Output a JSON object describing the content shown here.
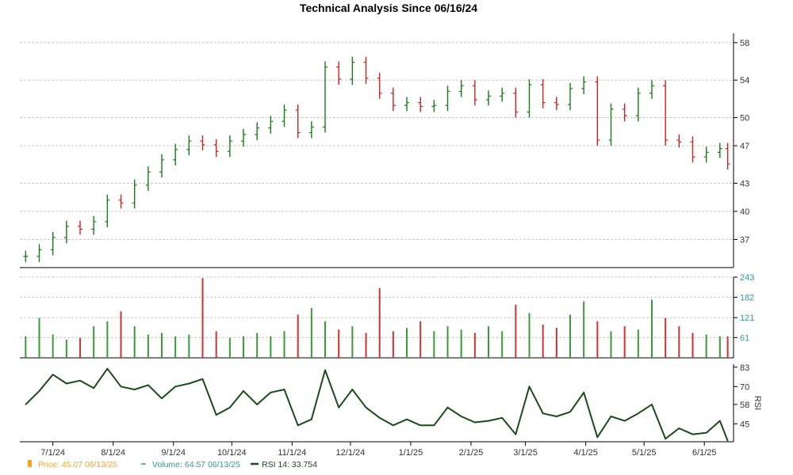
{
  "chart_data": {
    "type": "line",
    "title": "Technical Analysis Since 06/16/24",
    "x_ticks": [
      "7/1/24",
      "8/1/24",
      "9/1/24",
      "10/1/24",
      "11/1/24",
      "12/1/24",
      "1/1/25",
      "2/1/25",
      "3/1/25",
      "4/1/25",
      "5/1/25",
      "6/1/25"
    ],
    "price_panel": {
      "y_ticks": [
        37,
        40,
        43,
        47,
        50,
        54,
        58
      ],
      "ylim": [
        34,
        59
      ],
      "grid": true,
      "series": [
        {
          "name": "Price",
          "last_value": "45.07",
          "last_date": "06/13/25",
          "color_up": "#1a7a1a",
          "color_down": "#cc2222",
          "points": [
            [
              "2024-06-17",
              35.2
            ],
            [
              "2024-06-24",
              35.9
            ],
            [
              "2024-07-01",
              37.2
            ],
            [
              "2024-07-08",
              38.4
            ],
            [
              "2024-07-15",
              38.1
            ],
            [
              "2024-07-22",
              38.9
            ],
            [
              "2024-07-29",
              41.2
            ],
            [
              "2024-08-05",
              40.9
            ],
            [
              "2024-08-12",
              42.8
            ],
            [
              "2024-08-19",
              44.2
            ],
            [
              "2024-08-26",
              45.5
            ],
            [
              "2024-09-02",
              46.6
            ],
            [
              "2024-09-09",
              47.5
            ],
            [
              "2024-09-16",
              47.1
            ],
            [
              "2024-09-23",
              46.4
            ],
            [
              "2024-09-30",
              47.5
            ],
            [
              "2024-10-07",
              48.2
            ],
            [
              "2024-10-14",
              48.9
            ],
            [
              "2024-10-21",
              49.6
            ],
            [
              "2024-10-28",
              50.8
            ],
            [
              "2024-11-04",
              48.4
            ],
            [
              "2024-11-11",
              49.0
            ],
            [
              "2024-11-18",
              55.4
            ],
            [
              "2024-11-25",
              54.1
            ],
            [
              "2024-12-02",
              55.9
            ],
            [
              "2024-12-09",
              54.2
            ],
            [
              "2024-12-16",
              52.6
            ],
            [
              "2024-12-23",
              51.3
            ],
            [
              "2024-12-30",
              51.6
            ],
            [
              "2025-01-06",
              51.2
            ],
            [
              "2025-01-13",
              51.3
            ],
            [
              "2025-01-20",
              52.8
            ],
            [
              "2025-01-27",
              53.4
            ],
            [
              "2025-02-03",
              51.9
            ],
            [
              "2025-02-10",
              52.3
            ],
            [
              "2025-02-17",
              52.6
            ],
            [
              "2025-02-24",
              50.6
            ],
            [
              "2025-03-03",
              53.5
            ],
            [
              "2025-03-10",
              51.6
            ],
            [
              "2025-03-17",
              51.4
            ],
            [
              "2025-03-24",
              53.1
            ],
            [
              "2025-03-31",
              53.8
            ],
            [
              "2025-04-07",
              47.6
            ],
            [
              "2025-04-14",
              50.9
            ],
            [
              "2025-04-21",
              50.2
            ],
            [
              "2025-04-28",
              52.6
            ],
            [
              "2025-05-05",
              53.4
            ],
            [
              "2025-05-12",
              47.6
            ],
            [
              "2025-05-19",
              47.4
            ],
            [
              "2025-05-26",
              45.8
            ],
            [
              "2025-06-02",
              46.3
            ],
            [
              "2025-06-09",
              46.7
            ],
            [
              "2025-06-13",
              45.07
            ]
          ]
        }
      ]
    },
    "volume_panel": {
      "y_ticks": [
        61,
        121,
        182,
        243
      ],
      "ylim": [
        0,
        243
      ],
      "series": [
        {
          "name": "Volume",
          "last_value": "64.57",
          "last_date": "06/13/25",
          "color": "#339999",
          "points": [
            [
              "2024-06-17",
              65
            ],
            [
              "2024-06-24",
              120
            ],
            [
              "2024-07-01",
              70
            ],
            [
              "2024-07-08",
              55
            ],
            [
              "2024-07-15",
              60
            ],
            [
              "2024-07-22",
              95
            ],
            [
              "2024-07-29",
              110
            ],
            [
              "2024-08-05",
              140
            ],
            [
              "2024-08-12",
              95
            ],
            [
              "2024-08-19",
              70
            ],
            [
              "2024-08-26",
              75
            ],
            [
              "2024-09-02",
              65
            ],
            [
              "2024-09-09",
              70
            ],
            [
              "2024-09-16",
              240
            ],
            [
              "2024-09-23",
              80
            ],
            [
              "2024-09-30",
              60
            ],
            [
              "2024-10-07",
              65
            ],
            [
              "2024-10-14",
              75
            ],
            [
              "2024-10-21",
              65
            ],
            [
              "2024-10-28",
              80
            ],
            [
              "2024-11-04",
              130
            ],
            [
              "2024-11-11",
              150
            ],
            [
              "2024-11-18",
              110
            ],
            [
              "2024-11-25",
              85
            ],
            [
              "2024-12-02",
              95
            ],
            [
              "2024-12-09",
              75
            ],
            [
              "2024-12-16",
              210
            ],
            [
              "2024-12-23",
              80
            ],
            [
              "2024-12-30",
              90
            ],
            [
              "2025-01-06",
              110
            ],
            [
              "2025-01-13",
              80
            ],
            [
              "2025-01-20",
              95
            ],
            [
              "2025-01-27",
              85
            ],
            [
              "2025-02-03",
              75
            ],
            [
              "2025-02-10",
              95
            ],
            [
              "2025-02-17",
              80
            ],
            [
              "2025-02-24",
              160
            ],
            [
              "2025-03-03",
              135
            ],
            [
              "2025-03-10",
              100
            ],
            [
              "2025-03-17",
              90
            ],
            [
              "2025-03-24",
              130
            ],
            [
              "2025-03-31",
              170
            ],
            [
              "2025-04-07",
              110
            ],
            [
              "2025-04-14",
              80
            ],
            [
              "2025-04-21",
              95
            ],
            [
              "2025-04-28",
              85
            ],
            [
              "2025-05-05",
              175
            ],
            [
              "2025-05-12",
              120
            ],
            [
              "2025-05-19",
              95
            ],
            [
              "2025-05-26",
              75
            ],
            [
              "2025-06-02",
              70
            ],
            [
              "2025-06-09",
              65
            ],
            [
              "2025-06-13",
              64.57
            ]
          ]
        }
      ]
    },
    "rsi_panel": {
      "ylabel": "RSI",
      "y_ticks": [
        45,
        58,
        70,
        83
      ],
      "ylim": [
        33,
        85
      ],
      "series": [
        {
          "name": "RSI 14",
          "last_value": "33.754",
          "color": "#1a4a1a",
          "points": [
            [
              "2024-06-17",
              58
            ],
            [
              "2024-06-24",
              67
            ],
            [
              "2024-07-01",
              78
            ],
            [
              "2024-07-08",
              72
            ],
            [
              "2024-07-15",
              74
            ],
            [
              "2024-07-22",
              69
            ],
            [
              "2024-07-29",
              82
            ],
            [
              "2024-08-05",
              70
            ],
            [
              "2024-08-12",
              68
            ],
            [
              "2024-08-19",
              71
            ],
            [
              "2024-08-26",
              62
            ],
            [
              "2024-09-02",
              70
            ],
            [
              "2024-09-09",
              72
            ],
            [
              "2024-09-16",
              75
            ],
            [
              "2024-09-23",
              51
            ],
            [
              "2024-09-30",
              56
            ],
            [
              "2024-10-07",
              67
            ],
            [
              "2024-10-14",
              58
            ],
            [
              "2024-10-21",
              66
            ],
            [
              "2024-10-28",
              68
            ],
            [
              "2024-11-04",
              44
            ],
            [
              "2024-11-11",
              48
            ],
            [
              "2024-11-18",
              81
            ],
            [
              "2024-11-25",
              56
            ],
            [
              "2024-12-02",
              68
            ],
            [
              "2024-12-09",
              56
            ],
            [
              "2024-12-16",
              49
            ],
            [
              "2024-12-23",
              44
            ],
            [
              "2024-12-30",
              48
            ],
            [
              "2025-01-06",
              44
            ],
            [
              "2025-01-13",
              44
            ],
            [
              "2025-01-20",
              56
            ],
            [
              "2025-01-27",
              50
            ],
            [
              "2025-02-03",
              46
            ],
            [
              "2025-02-10",
              47
            ],
            [
              "2025-02-17",
              49
            ],
            [
              "2025-02-24",
              38
            ],
            [
              "2025-03-03",
              70
            ],
            [
              "2025-03-10",
              52
            ],
            [
              "2025-03-17",
              50
            ],
            [
              "2025-03-24",
              53
            ],
            [
              "2025-03-31",
              66
            ],
            [
              "2025-04-07",
              36
            ],
            [
              "2025-04-14",
              50
            ],
            [
              "2025-04-21",
              47
            ],
            [
              "2025-04-28",
              52
            ],
            [
              "2025-05-05",
              58
            ],
            [
              "2025-05-12",
              35
            ],
            [
              "2025-05-19",
              42
            ],
            [
              "2025-05-26",
              38
            ],
            [
              "2025-06-02",
              39
            ],
            [
              "2025-06-09",
              47
            ],
            [
              "2025-06-13",
              33.754
            ]
          ]
        }
      ]
    }
  },
  "legend": {
    "price_label": "Price: 45.07  06/13/25",
    "volume_label": "Volume: 64.57  06/13/25",
    "rsi_label": "RSI 14: 33.754",
    "price_color": "#f5a623",
    "volume_color": "#339999",
    "rsi_color": "#1a4a1a"
  }
}
